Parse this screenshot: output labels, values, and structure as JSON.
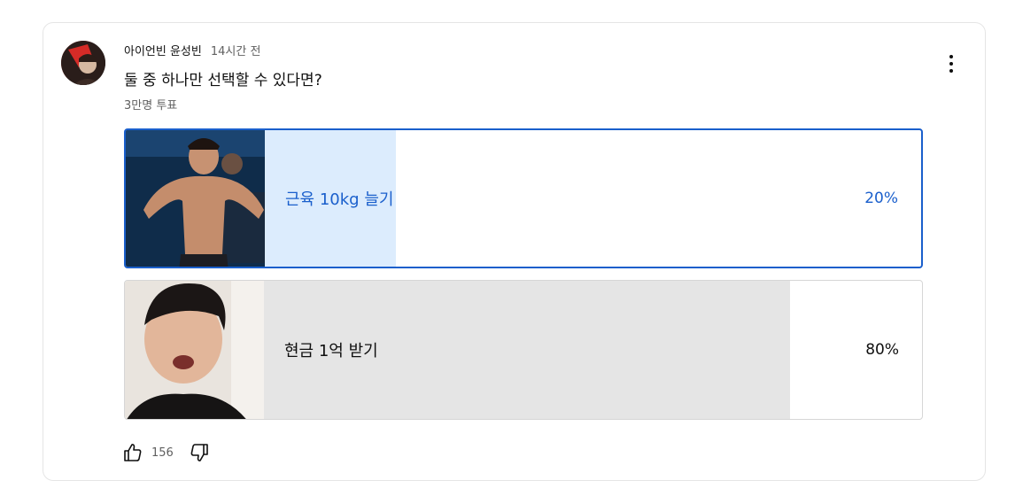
{
  "post": {
    "author": "아이언빈 윤성빈",
    "time": "14시간 전",
    "question": "둘 중 하나만 선택할 수 있다면?",
    "vote_count": "3만명 투표"
  },
  "poll": {
    "options": [
      {
        "label": "근육 10kg 늘기",
        "percent_text": "20%",
        "percent": 20,
        "selected": true
      },
      {
        "label": "현금 1억 받기",
        "percent_text": "80%",
        "percent": 80,
        "selected": false
      }
    ]
  },
  "actions": {
    "like_count": "156"
  },
  "colors": {
    "selected_accent": "#1a5fcc",
    "selected_fill": "#dcecfd",
    "unselected_fill": "#e5e5e5",
    "secondary_text": "#606060"
  },
  "icons": [
    "more-vert-icon",
    "thumbs-up-icon",
    "thumbs-down-icon"
  ]
}
